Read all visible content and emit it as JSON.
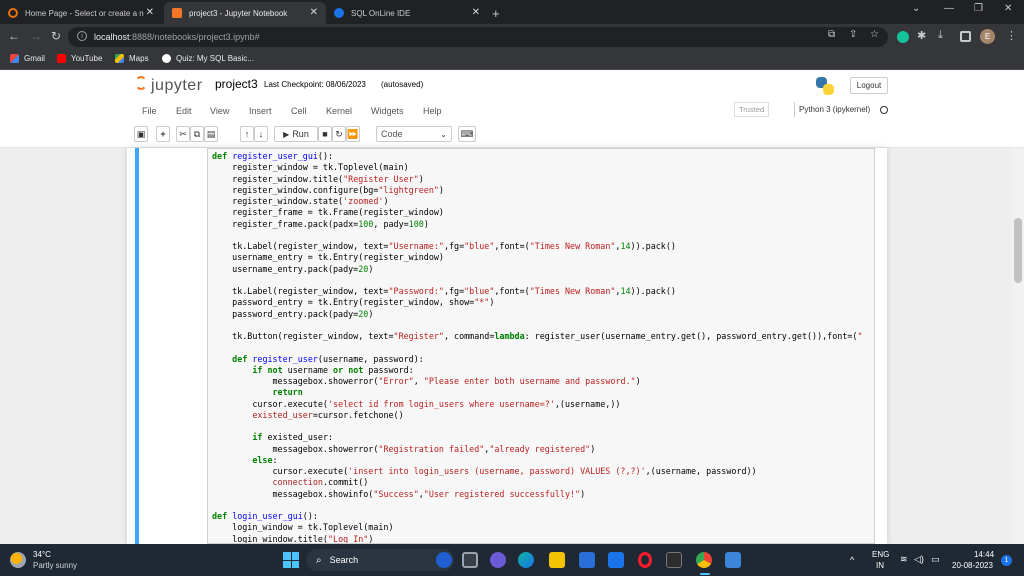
{
  "browser": {
    "tabs": [
      {
        "title": "Home Page - Select or create a n"
      },
      {
        "title": "project3 - Jupyter Notebook"
      },
      {
        "title": "SQL OnLine IDE"
      }
    ],
    "url_host": "localhost",
    "url_path": ":8888/notebooks/project3.ipynb#",
    "profile_initial": "E",
    "bookmarks": [
      {
        "label": "Gmail"
      },
      {
        "label": "YouTube"
      },
      {
        "label": "Maps"
      },
      {
        "label": "Quiz: My SQL Basic..."
      }
    ]
  },
  "jupyter": {
    "logo_text": "jupyter",
    "notebook_name": "project3",
    "checkpoint": "Last Checkpoint: 08/06/2023",
    "autosave": "(autosaved)",
    "logout_label": "Logout",
    "menus": [
      "File",
      "Edit",
      "View",
      "Insert",
      "Cell",
      "Kernel",
      "Widgets",
      "Help"
    ],
    "trusted_label": "Trusted",
    "kernel_label": "Python 3 (ipykernel)",
    "run_label": "Run",
    "cell_type": "Code"
  },
  "taskbar": {
    "weather_temp": "34°C",
    "weather_desc": "Partly sunny",
    "search_placeholder": "Search",
    "lang_top": "ENG",
    "lang_bottom": "IN",
    "time": "14:44",
    "date": "20-08-2023"
  }
}
